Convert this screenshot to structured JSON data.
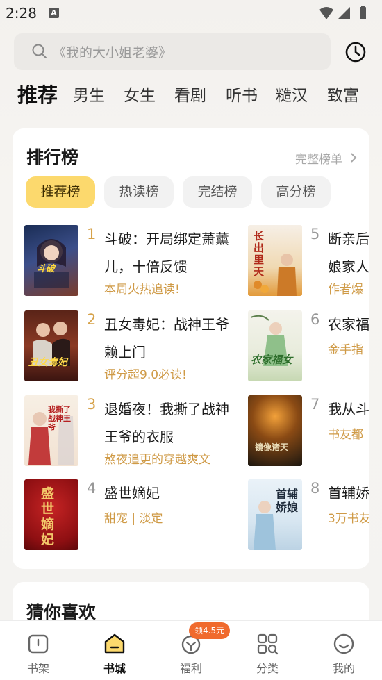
{
  "status": {
    "time": "2:28",
    "notif_letter": "A"
  },
  "search": {
    "placeholder": "《我的大小姐老婆》"
  },
  "tabs": [
    "推荐",
    "男生",
    "女生",
    "看剧",
    "听书",
    "糙汉",
    "致富"
  ],
  "ranking": {
    "title": "排行榜",
    "more": "完整榜单",
    "filters": [
      "推荐榜",
      "热读榜",
      "完结榜",
      "高分榜"
    ],
    "books": [
      {
        "rank": "1",
        "title": "斗破：开局绑定萧薰儿，十倍反馈",
        "tag": "本周火热追读!",
        "cover_text": "斗破"
      },
      {
        "rank": "2",
        "title": "丑女毒妃：战神王爷赖上门",
        "tag": "评分超9.0必读!",
        "cover_text": "丑女毒妃"
      },
      {
        "rank": "3",
        "title": "退婚夜！我撕了战神王爷的衣服",
        "tag": "熬夜追更的穿越爽文",
        "cover_text": "我撕了战神王爷"
      },
      {
        "rank": "4",
        "title": "盛世嫡妃",
        "tag": "甜宠 | 淡定",
        "cover_text": "盛世嫡妃"
      },
      {
        "rank": "5",
        "title": "断亲后",
        "title2": "娘家人",
        "tag": "作者爆",
        "cover_text": "长出里天"
      },
      {
        "rank": "6",
        "title": "农家福",
        "tag": "金手指",
        "cover_text": "农家福女"
      },
      {
        "rank": "7",
        "title": "我从斗",
        "tag": "书友都",
        "cover_text": "镜像诸天"
      },
      {
        "rank": "8",
        "title": "首辅娇",
        "tag": "3万书友",
        "cover_text": "首辅娇娘"
      }
    ]
  },
  "guess": {
    "title": "猜你喜欢"
  },
  "nav": {
    "items": [
      "书架",
      "书城",
      "福利",
      "分类",
      "我的"
    ],
    "badge": "领4.5元"
  },
  "colors": {
    "accent": "#fcd96d",
    "tag": "#cf9a46",
    "badge": "#f06a2d"
  }
}
